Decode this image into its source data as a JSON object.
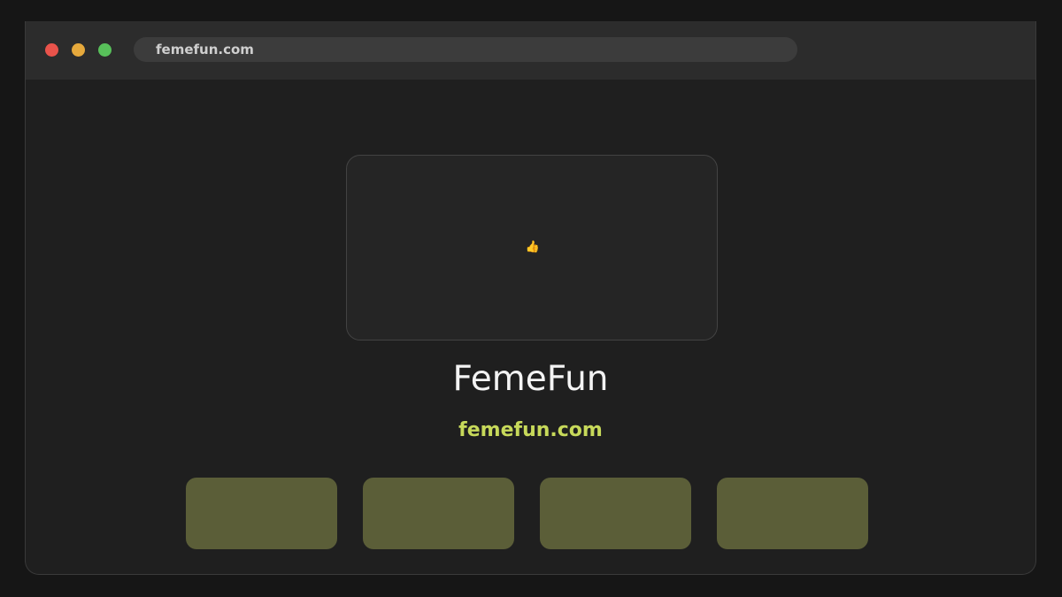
{
  "browser": {
    "address": "femefun.com",
    "controls": [
      "close",
      "minimize",
      "maximize"
    ]
  },
  "hero": {
    "icon": "thumbs-up-icon",
    "icon_glyph": "👍"
  },
  "site": {
    "title": "FemeFun",
    "domain": "femefun.com"
  },
  "tiles": [
    "",
    "",
    "",
    ""
  ],
  "colors": {
    "page_background": "#161616",
    "window_background": "#1f1f1f",
    "titlebar": "#2c2c2c",
    "address_bar": "#3c3c3c",
    "accent": "#c7d95a",
    "tile": "#5b5e38",
    "close": "#e9534b",
    "minimize": "#e6a93c",
    "maximize": "#58c05a"
  }
}
